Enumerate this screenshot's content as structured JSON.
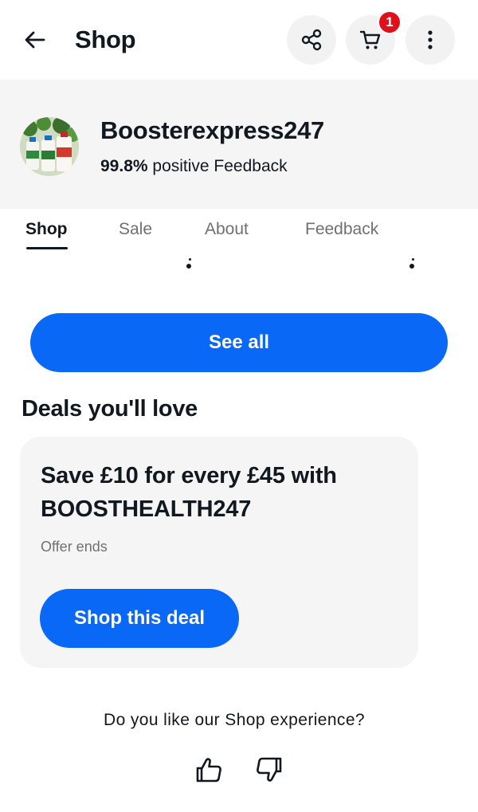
{
  "header": {
    "title": "Shop",
    "cart_count": "1",
    "icons": [
      "back-arrow-icon",
      "share-icon",
      "cart-icon",
      "more-vertical-icon"
    ]
  },
  "seller": {
    "name": "Boosterexpress247",
    "feedback_percent": "99.8%",
    "feedback_label": "positive Feedback"
  },
  "tabs": [
    {
      "label": "Shop",
      "active": true
    },
    {
      "label": "Sale",
      "active": false
    },
    {
      "label": "About",
      "active": false
    },
    {
      "label": "Feedback",
      "active": false
    }
  ],
  "see_all_label": "See all",
  "deals": {
    "section_title": "Deals you'll love",
    "card": {
      "title": "Save £10 for every £45 with BOOSTHEALTH247",
      "subtitle": "Offer ends",
      "button_label": "Shop this deal"
    }
  },
  "feedback_prompt": {
    "question": "Do you like our Shop experience?"
  },
  "colors": {
    "accent": "#0968f6",
    "badge": "#e0101a",
    "panel": "#f5f5f5",
    "text": "#111820",
    "muted": "#707070"
  }
}
